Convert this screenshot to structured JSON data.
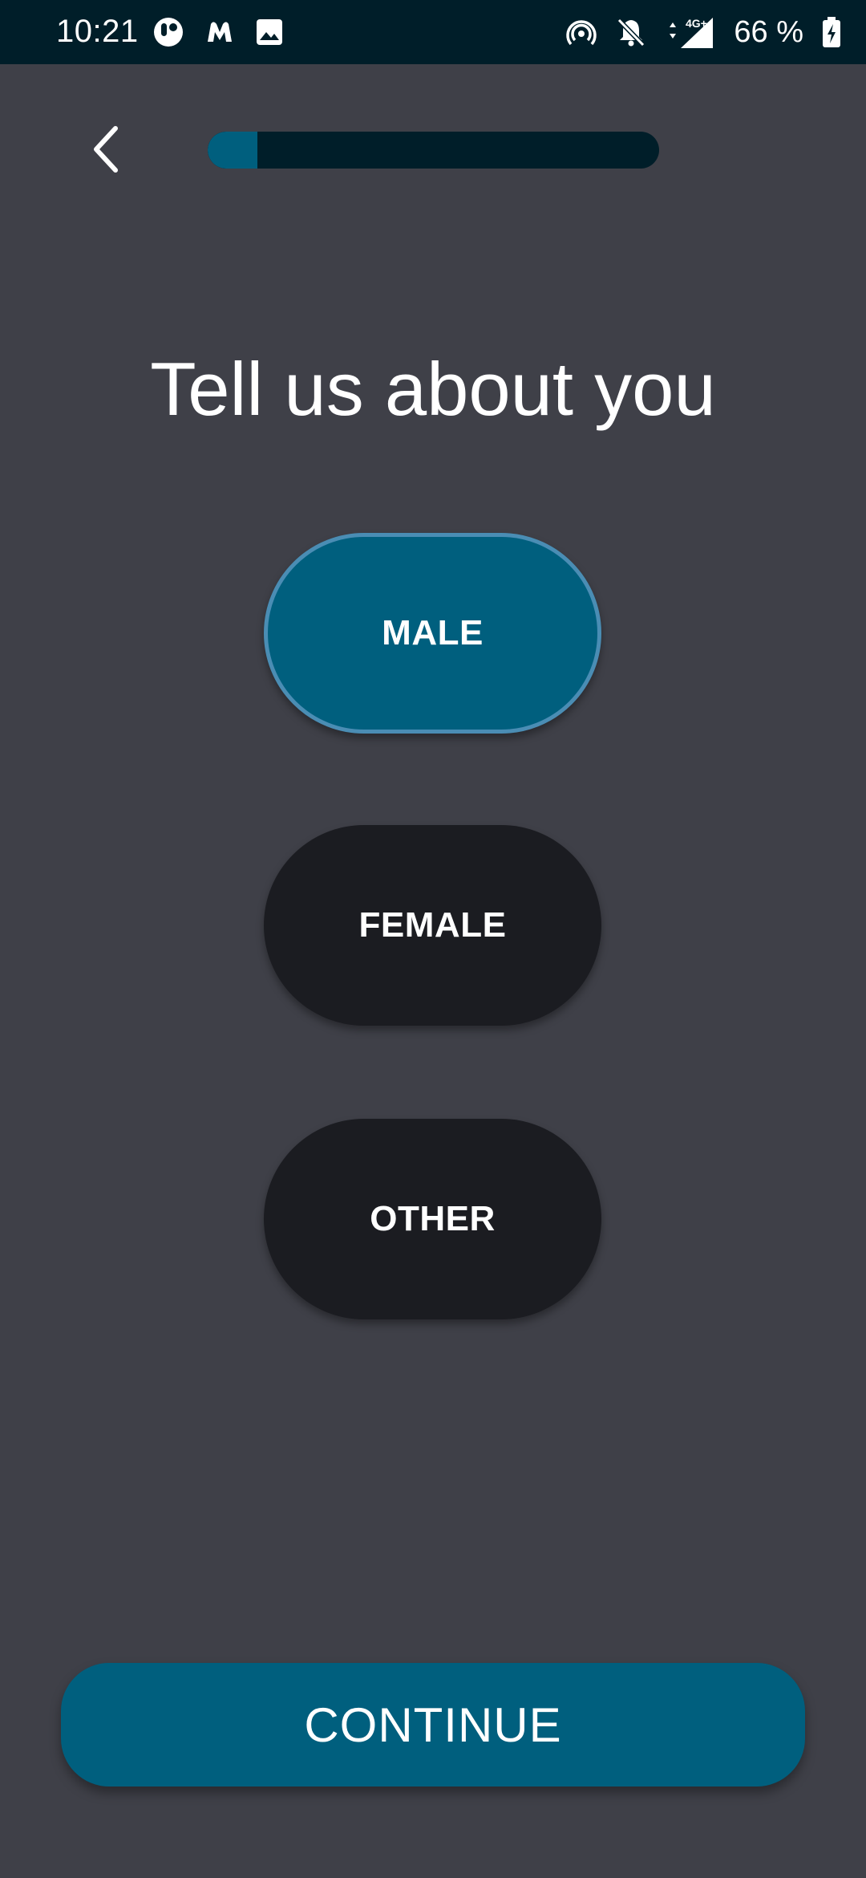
{
  "status_bar": {
    "time": "10:21",
    "battery_text": "66 %",
    "network": "4G+",
    "icons_left": [
      "nfc-like-app-icon",
      "malwarebytes-icon",
      "image-icon"
    ],
    "icons_right": [
      "hotspot-icon",
      "bell-off-icon",
      "data-arrows-icon",
      "signal-icon",
      "battery-charging-icon"
    ],
    "background": "#001e29"
  },
  "header": {
    "back_icon": "chevron-left-icon",
    "progress_fraction": 0.11,
    "progress_fill_color": "#005f7e",
    "progress_track_color": "#001e29"
  },
  "main": {
    "title": "Tell us about you",
    "options": [
      {
        "label": "MALE",
        "selected": true
      },
      {
        "label": "FEMALE",
        "selected": false
      },
      {
        "label": "OTHER",
        "selected": false
      }
    ],
    "selected_color": "#005f7e",
    "unselected_color": "#1b1c21"
  },
  "footer": {
    "continue_label": "CONTINUE",
    "continue_color": "#005f7e"
  },
  "colors": {
    "background": "#3f4048",
    "text": "#ffffff"
  }
}
